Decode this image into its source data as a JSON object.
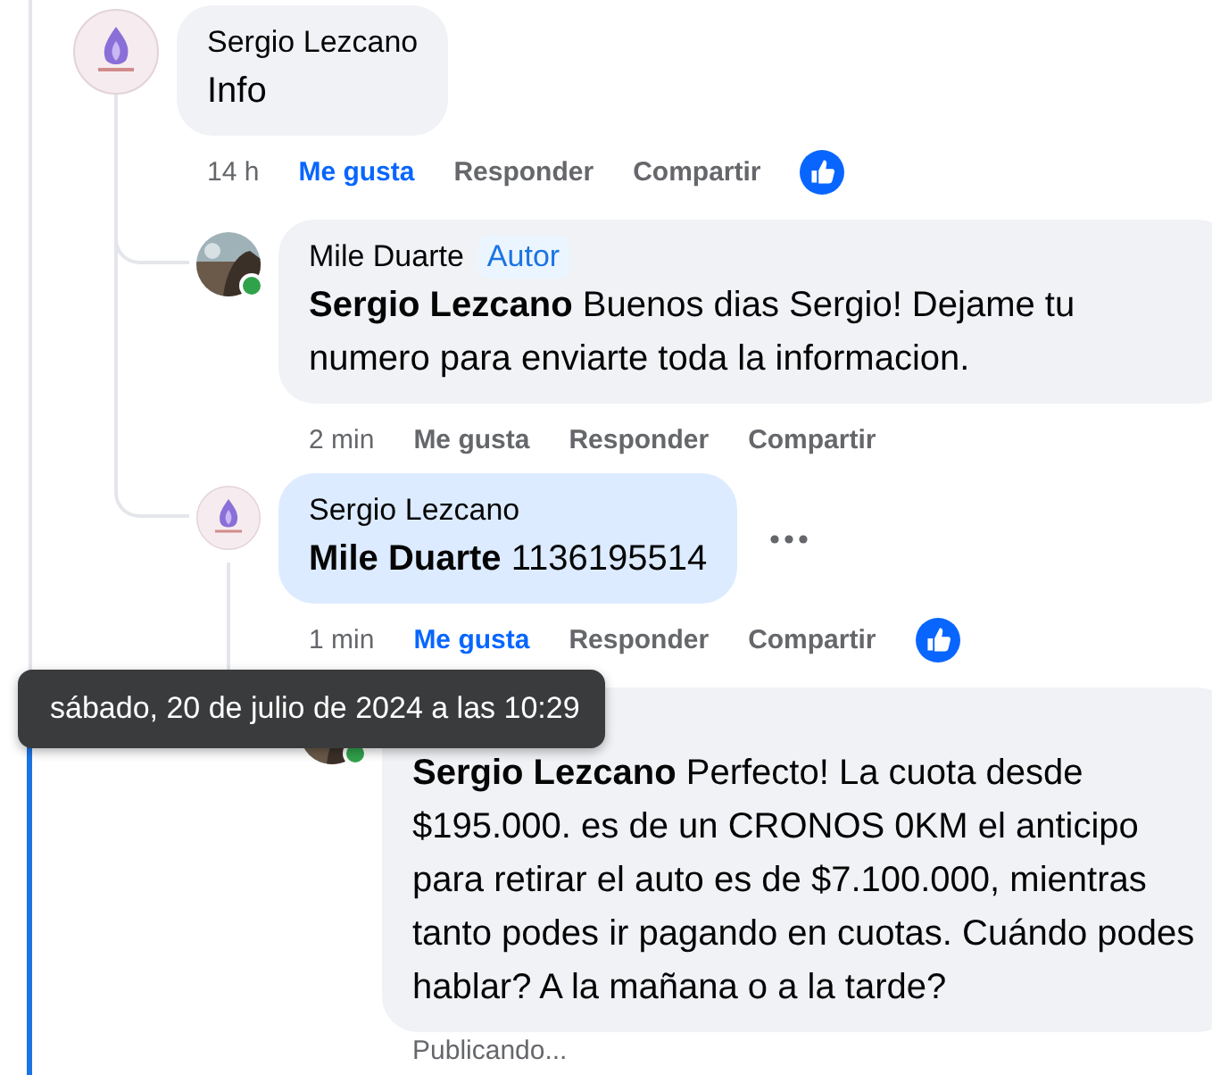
{
  "comments": [
    {
      "author": "Sergio Lezcano",
      "avatar": {
        "kind": "logo"
      },
      "online": false,
      "text": "Info",
      "highlighted": false,
      "time": "14 h",
      "actions": [
        "Me gusta",
        "Responder",
        "Compartir"
      ],
      "liked": true,
      "reactions": true,
      "more_button": false,
      "children": [
        {
          "author": "Mile Duarte",
          "avatar": {
            "kind": "photo"
          },
          "online": true,
          "badge": "Autor",
          "text": "**Sergio Lezcano** Buenos dias Sergio! Dejame tu numero para enviarte toda la informacion.",
          "highlighted": false,
          "time": "2 min",
          "actions": [
            "Me gusta",
            "Responder",
            "Compartir"
          ],
          "liked": false,
          "reactions": false,
          "more_button": false
        },
        {
          "author": "Sergio Lezcano",
          "avatar": {
            "kind": "logo"
          },
          "online": false,
          "text": "**Mile Duarte** 1136195514",
          "highlighted": true,
          "time": "1 min",
          "actions": [
            "Me gusta",
            "Responder",
            "Compartir"
          ],
          "liked": true,
          "reactions": true,
          "more_button": true,
          "children": [
            {
              "avatar": {
                "kind": "photo"
              },
              "online": true,
              "more_button": false,
              "text": "**Sergio Lezcano** Perfecto! La cuota desde $195.000. es de un CRONOS 0KM el anticipo para retirar el auto es de $7.100.000, mientras tanto podes ir pagando en cuotas. Cuándo podes hablar? A la mañana o a la tarde?",
              "highlighted": false,
              "status": "Publicando..."
            }
          ]
        }
      ]
    }
  ],
  "tooltip": "sábado, 20 de julio de 2024 a las 10:29"
}
